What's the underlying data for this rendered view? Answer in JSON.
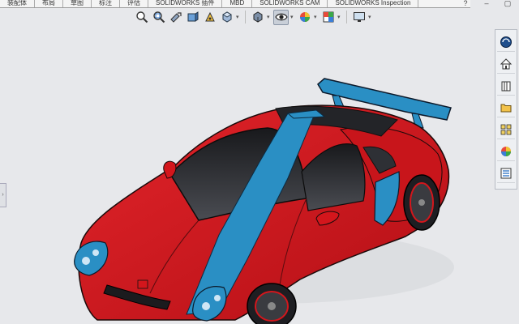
{
  "tabs": [
    "装配体",
    "布局",
    "草图",
    "标注",
    "评估",
    "SOLIDWORKS 插件",
    "MBD",
    "SOLIDWORKS CAM",
    "SOLIDWORKS Inspection"
  ],
  "window_controls": [
    "?",
    "–",
    "▢"
  ],
  "heads_up_toolbar": {
    "icons": [
      "zoom-to-fit-icon",
      "zoom-area-icon",
      "previous-view-icon",
      "section-view-icon",
      "dynamic-annotation-icon",
      "view-orientation-icon",
      "display-style-icon",
      "hide-show-items-icon",
      "edit-appearance-icon",
      "apply-scene-icon",
      "view-settings-icon"
    ]
  },
  "task_pane": {
    "icons": [
      "solidworks-resources-icon",
      "home-icon",
      "design-library-icon",
      "file-explorer-icon",
      "view-palette-icon",
      "appearances-icon",
      "custom-properties-icon"
    ]
  },
  "colors": {
    "body_red": "#d3161c",
    "stripe_blue": "#2a8fc4",
    "glass": "#2b2d31",
    "background": "#e7e8eb"
  }
}
